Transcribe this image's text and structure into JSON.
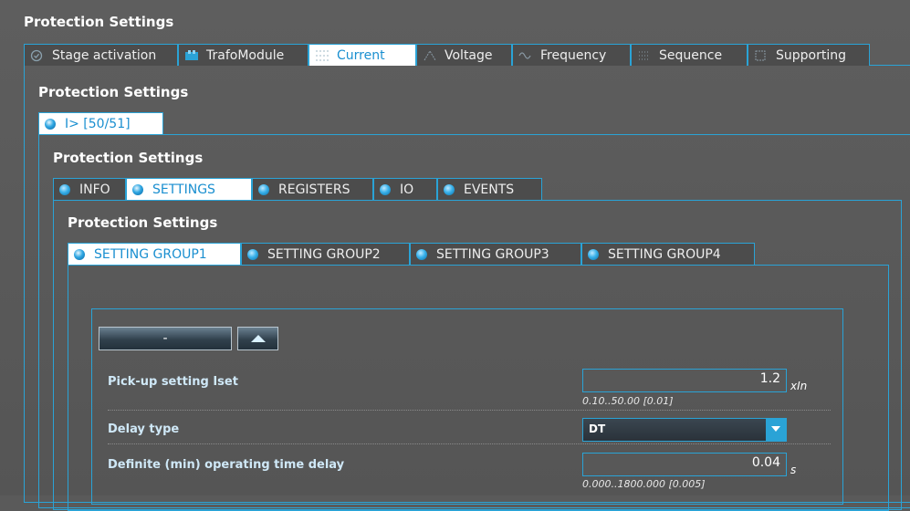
{
  "page": {
    "title": "Protection Settings"
  },
  "main_tabs": [
    {
      "label": "Stage activation",
      "icon": "check-circle-icon"
    },
    {
      "label": "TrafoModule",
      "icon": "transformer-icon"
    },
    {
      "label": "Current",
      "icon": "current-icon"
    },
    {
      "label": "Voltage",
      "icon": "voltage-icon"
    },
    {
      "label": "Frequency",
      "icon": "frequency-icon"
    },
    {
      "label": "Sequence",
      "icon": "sequence-icon"
    },
    {
      "label": "Supporting",
      "icon": "supporting-icon"
    }
  ],
  "active_main_tab": "Current",
  "level2": {
    "title": "Protection Settings",
    "tab": {
      "label": "I> [50/51]"
    }
  },
  "level3": {
    "title": "Protection Settings",
    "tabs": [
      {
        "label": "INFO"
      },
      {
        "label": "SETTINGS"
      },
      {
        "label": "REGISTERS"
      },
      {
        "label": "IO"
      },
      {
        "label": "EVENTS"
      }
    ],
    "active": "SETTINGS"
  },
  "level4": {
    "title": "Protection Settings",
    "tabs": [
      {
        "label": "SETTING GROUP1"
      },
      {
        "label": "SETTING GROUP2"
      },
      {
        "label": "SETTING GROUP3"
      },
      {
        "label": "SETTING GROUP4"
      }
    ],
    "active": "SETTING GROUP1"
  },
  "panel": {
    "collapse_label": "-",
    "fields": [
      {
        "label": "Pick-up setting Iset",
        "value": "1.2",
        "unit": "xIn",
        "range": "0.10..50.00 [0.01]"
      },
      {
        "label": "Delay type",
        "value": "DT"
      },
      {
        "label": "Definite (min) operating time delay",
        "value": "0.04",
        "unit": "s",
        "range": "0.000..1800.000 [0.005]"
      }
    ]
  },
  "colors": {
    "accent": "#2aa3d6",
    "background": "#5a5a5a",
    "label": "#cfe8f7"
  }
}
